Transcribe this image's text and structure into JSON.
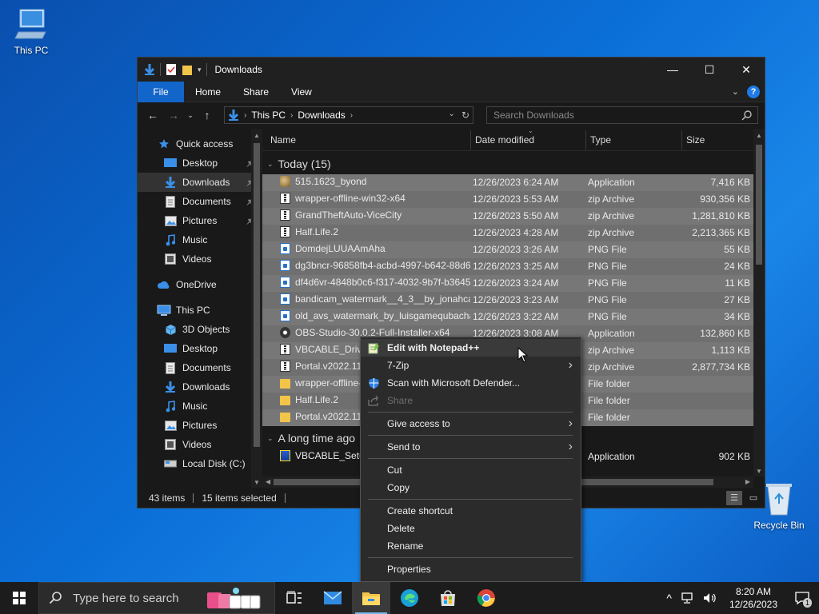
{
  "desktop": {
    "this_pc": "This PC",
    "recycle_bin": "Recycle Bin"
  },
  "window": {
    "title": "Downloads",
    "controls": {
      "minimize": "—",
      "maximize": "☐",
      "close": "✕"
    },
    "ribbon_tabs": [
      "File",
      "Home",
      "Share",
      "View"
    ],
    "help": "?",
    "address": {
      "crumbs": [
        "This PC",
        "Downloads"
      ]
    },
    "search_placeholder": "Search Downloads",
    "columns": {
      "name": "Name",
      "date": "Date modified",
      "type": "Type",
      "size": "Size"
    },
    "group_today": "Today (15)",
    "group_older": "A long time ago",
    "nav": [
      {
        "label": "Quick access",
        "icon": "star-icon",
        "indent": 24,
        "pinned": false
      },
      {
        "label": "Desktop",
        "icon": "desktop-icon",
        "indent": 32,
        "pinned": true
      },
      {
        "label": "Downloads",
        "icon": "download-icon",
        "indent": 32,
        "pinned": true,
        "selected": true
      },
      {
        "label": "Documents",
        "icon": "document-icon",
        "indent": 32,
        "pinned": true
      },
      {
        "label": "Pictures",
        "icon": "picture-icon",
        "indent": 32,
        "pinned": true
      },
      {
        "label": "Music",
        "icon": "music-icon",
        "indent": 32,
        "pinned": false
      },
      {
        "label": "Videos",
        "icon": "video-icon",
        "indent": 32,
        "pinned": false
      },
      {
        "gap": true
      },
      {
        "label": "OneDrive",
        "icon": "cloud-icon",
        "indent": 24,
        "pinned": false
      },
      {
        "gap": true
      },
      {
        "label": "This PC",
        "icon": "computer-icon",
        "indent": 24,
        "pinned": false
      },
      {
        "label": "3D Objects",
        "icon": "cube-icon",
        "indent": 32,
        "pinned": false
      },
      {
        "label": "Desktop",
        "icon": "desktop-icon",
        "indent": 32,
        "pinned": false
      },
      {
        "label": "Documents",
        "icon": "document-icon",
        "indent": 32,
        "pinned": false
      },
      {
        "label": "Downloads",
        "icon": "download-icon",
        "indent": 32,
        "pinned": false
      },
      {
        "label": "Music",
        "icon": "music-icon",
        "indent": 32,
        "pinned": false
      },
      {
        "label": "Pictures",
        "icon": "picture-icon",
        "indent": 32,
        "pinned": false
      },
      {
        "label": "Videos",
        "icon": "video-icon",
        "indent": 32,
        "pinned": false
      },
      {
        "label": "Local Disk (C:)",
        "icon": "drive-icon",
        "indent": 32,
        "pinned": false
      }
    ],
    "files": [
      {
        "name": "515.1623_byond",
        "date": "12/26/2023 6:24 AM",
        "type": "Application",
        "size": "7,416 KB",
        "icon": "app"
      },
      {
        "name": "wrapper-offline-win32-x64",
        "date": "12/26/2023 5:53 AM",
        "type": "zip Archive",
        "size": "930,356 KB",
        "icon": "zip"
      },
      {
        "name": "GrandTheftAuto-ViceCity",
        "date": "12/26/2023 5:50 AM",
        "type": "zip Archive",
        "size": "1,281,810 KB",
        "icon": "zip"
      },
      {
        "name": "Half.Life.2",
        "date": "12/26/2023 4:28 AM",
        "type": "zip Archive",
        "size": "2,213,365 KB",
        "icon": "zip"
      },
      {
        "name": "DomdejLUUAAmAha",
        "date": "12/26/2023 3:26 AM",
        "type": "PNG File",
        "size": "55 KB",
        "icon": "png"
      },
      {
        "name": "dg3bncr-96858fb4-acbd-4997-b642-88d6...",
        "date": "12/26/2023 3:25 AM",
        "type": "PNG File",
        "size": "24 KB",
        "icon": "png"
      },
      {
        "name": "df4d6vr-4848b0c6-f317-4032-9b7f-b3645...",
        "date": "12/26/2023 3:24 AM",
        "type": "PNG File",
        "size": "11 KB",
        "icon": "png"
      },
      {
        "name": "bandicam_watermark__4_3__by_jonahca...",
        "date": "12/26/2023 3:23 AM",
        "type": "PNG File",
        "size": "27 KB",
        "icon": "png"
      },
      {
        "name": "old_avs_watermark_by_luisgamequbacha...",
        "date": "12/26/2023 3:22 AM",
        "type": "PNG File",
        "size": "34 KB",
        "icon": "png"
      },
      {
        "name": "OBS-Studio-30.0.2-Full-Installer-x64",
        "date": "12/26/2023 3:08 AM",
        "type": "Application",
        "size": "132,860 KB",
        "icon": "obs"
      },
      {
        "name": "VBCABLE_Driver_Pack43",
        "date": "",
        "type": "zip Archive",
        "size": "1,113 KB",
        "icon": "zip"
      },
      {
        "name": "Portal.v2022.11",
        "date": "",
        "type": "zip Archive",
        "size": "2,877,734 KB",
        "icon": "zip"
      },
      {
        "name": "wrapper-offline-win32-x64",
        "date": "",
        "type": "File folder",
        "size": "",
        "icon": "folder"
      },
      {
        "name": "Half.Life.2",
        "date": "",
        "type": "File folder",
        "size": "",
        "icon": "folder"
      },
      {
        "name": "Portal.v2022.11",
        "date": "",
        "type": "File folder",
        "size": "",
        "icon": "folder"
      }
    ],
    "older_files": [
      {
        "name": "VBCABLE_Setup_x64",
        "date": "",
        "type": "Application",
        "size": "902 KB",
        "icon": "setup"
      }
    ],
    "status": {
      "count": "43 items",
      "selected": "15 items selected"
    }
  },
  "context_menu": {
    "items": [
      {
        "label": "Edit with Notepad++",
        "icon": "notepad-icon",
        "bold": true
      },
      {
        "label": "7-Zip",
        "submenu": true
      },
      {
        "label": "Scan with Microsoft Defender...",
        "icon": "defender-shield-icon"
      },
      {
        "label": "Share",
        "icon": "share-icon",
        "disabled": true
      },
      {
        "sep": true
      },
      {
        "label": "Give access to",
        "submenu": true
      },
      {
        "sep": true
      },
      {
        "label": "Send to",
        "submenu": true
      },
      {
        "sep": true
      },
      {
        "label": "Cut"
      },
      {
        "label": "Copy"
      },
      {
        "sep": true
      },
      {
        "label": "Create shortcut"
      },
      {
        "label": "Delete"
      },
      {
        "label": "Rename"
      },
      {
        "sep": true
      },
      {
        "label": "Properties"
      }
    ]
  },
  "taskbar": {
    "search_placeholder": "Type here to search",
    "time": "8:20 AM",
    "date": "12/26/2023",
    "notification_count": "1"
  }
}
